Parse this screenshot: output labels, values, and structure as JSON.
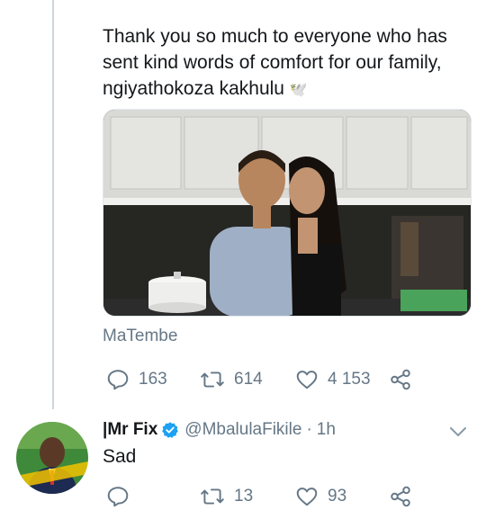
{
  "tweet": {
    "text": "Thank you so much to everyone who has sent kind words of comfort for our family, ngiyathokoza kakhulu",
    "emoji": "🕊️",
    "media_caption": "MaTembe",
    "stats": {
      "replies": "163",
      "retweets": "614",
      "likes": "4 153"
    }
  },
  "reply": {
    "name": "|Mr Fix",
    "handle": "@MbalulaFikile",
    "separator": "·",
    "time": "1h",
    "text": "Sad",
    "stats": {
      "replies": "",
      "retweets": "13",
      "likes": "93"
    }
  },
  "colors": {
    "text_primary": "#14171a",
    "text_secondary": "#657786",
    "verified_blue": "#1da1f2",
    "thread_line": "#ccd6dd"
  },
  "icons": {
    "reply": "reply-bubble-icon",
    "retweet": "retweet-icon",
    "like": "heart-icon",
    "share": "share-icon",
    "verified": "verified-badge-icon",
    "menu": "chevron-down-icon"
  }
}
